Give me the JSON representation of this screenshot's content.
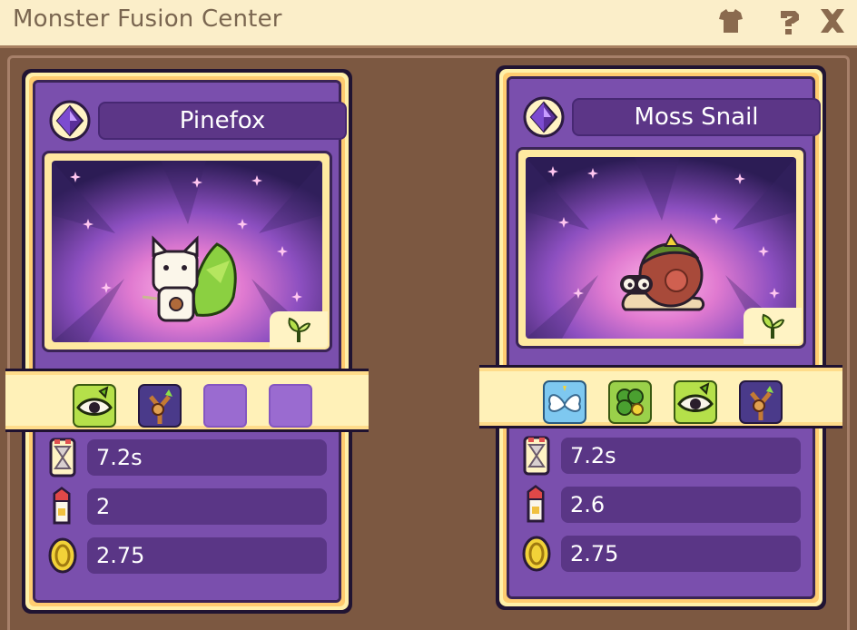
{
  "window": {
    "title": "Monster Fusion Center",
    "icons": [
      "shirt-icon",
      "help-icon",
      "close-icon"
    ]
  },
  "cards": [
    {
      "name": "Pinefox",
      "element_icon": "sprout-icon",
      "monster_icon": "pinefox-sprite",
      "slots": [
        {
          "icon": "seed-eye-icon",
          "filled": true
        },
        {
          "icon": "slingshot-icon",
          "filled": true
        },
        {
          "icon": "",
          "filled": false
        },
        {
          "icon": "",
          "filled": false
        }
      ],
      "stats": [
        {
          "icon": "hourglass-icon",
          "value": "7.2s"
        },
        {
          "icon": "milk-carton-icon",
          "value": "2"
        },
        {
          "icon": "coin-icon",
          "value": "2.75"
        }
      ]
    },
    {
      "name": "Moss Snail",
      "element_icon": "sprout-icon",
      "monster_icon": "moss-snail-sprite",
      "slots": [
        {
          "icon": "fairy-wings-icon",
          "filled": true
        },
        {
          "icon": "clover-icon",
          "filled": true
        },
        {
          "icon": "seed-eye-icon",
          "filled": true
        },
        {
          "icon": "slingshot-icon",
          "filled": true
        }
      ],
      "stats": [
        {
          "icon": "hourglass-icon",
          "value": "7.2s"
        },
        {
          "icon": "milk-carton-icon",
          "value": "2.6"
        },
        {
          "icon": "coin-icon",
          "value": "2.75"
        }
      ]
    }
  ],
  "colors": {
    "card_purple": "#7a4fad",
    "name_box": "#5c3687",
    "gold": "#ffcc70",
    "frame_brown": "#7c5841"
  }
}
